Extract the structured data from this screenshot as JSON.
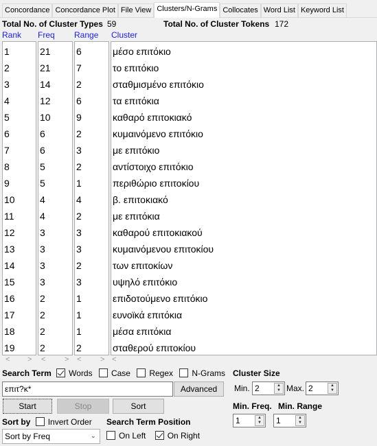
{
  "tabs": [
    "Concordance",
    "Concordance Plot",
    "File View",
    "Clusters/N-Grams",
    "Collocates",
    "Word List",
    "Keyword List"
  ],
  "active_tab": "Clusters/N-Grams",
  "stats": {
    "types_label": "Total No. of Cluster Types",
    "types_value": "59",
    "tokens_label": "Total No. of Cluster Tokens",
    "tokens_value": "172"
  },
  "columns": {
    "rank": "Rank",
    "freq": "Freq",
    "range": "Range",
    "cluster": "Cluster"
  },
  "rows": [
    [
      "1",
      "21",
      "6",
      "μέσο επιτόκιο"
    ],
    [
      "2",
      "21",
      "7",
      "το επιτόκιο"
    ],
    [
      "3",
      "14",
      "2",
      "σταθμισμένο επιτόκιο"
    ],
    [
      "4",
      "12",
      "6",
      "τα επιτόκια"
    ],
    [
      "5",
      "10",
      "9",
      "καθαρό επιτοκιακό"
    ],
    [
      "6",
      "6",
      "2",
      "κυμαινόμενο επιτόκιο"
    ],
    [
      "7",
      "6",
      "3",
      "με επιτόκιο"
    ],
    [
      "8",
      "5",
      "2",
      "αντίστοιχο επιτόκιο"
    ],
    [
      "9",
      "5",
      "1",
      "περιθώριο επιτοκίου"
    ],
    [
      "10",
      "4",
      "4",
      "β. επιτοκιακό"
    ],
    [
      "11",
      "4",
      "2",
      "με επιτόκια"
    ],
    [
      "12",
      "3",
      "3",
      "καθαρού επιτοκιακού"
    ],
    [
      "13",
      "3",
      "3",
      "κυμαινόμενου επιτοκίου"
    ],
    [
      "14",
      "3",
      "2",
      "των επιτοκίων"
    ],
    [
      "15",
      "3",
      "3",
      "υψηλό επιτόκιο"
    ],
    [
      "16",
      "2",
      "1",
      "επιδοτούμενο επιτόκιο"
    ],
    [
      "17",
      "2",
      "1",
      "ευνοϊκά επιτόκια"
    ],
    [
      "18",
      "2",
      "1",
      "μέσα επιτόκια"
    ],
    [
      "19",
      "2",
      "2",
      "σταθερού επιτοκίου"
    ]
  ],
  "search": {
    "label": "Search Term",
    "words": "Words",
    "words_checked": true,
    "case": "Case",
    "case_checked": false,
    "regex": "Regex",
    "regex_checked": false,
    "ngrams": "N-Grams",
    "ngrams_checked": false,
    "value": "επιτ?κ*",
    "advanced": "Advanced"
  },
  "buttons": {
    "start": "Start",
    "stop": "Stop",
    "sort": "Sort"
  },
  "sort": {
    "label": "Sort by",
    "invert": "Invert Order",
    "invert_checked": false,
    "selected": "Sort by Freq"
  },
  "position": {
    "label": "Search Term Position",
    "left": "On Left",
    "left_checked": false,
    "right": "On Right",
    "right_checked": true
  },
  "cluster_size": {
    "label": "Cluster Size",
    "min_label": "Min.",
    "min": "2",
    "max_label": "Max.",
    "max": "2"
  },
  "min_freq": {
    "label": "Min. Freq.",
    "value": "1"
  },
  "min_range": {
    "label": "Min. Range",
    "value": "1"
  }
}
